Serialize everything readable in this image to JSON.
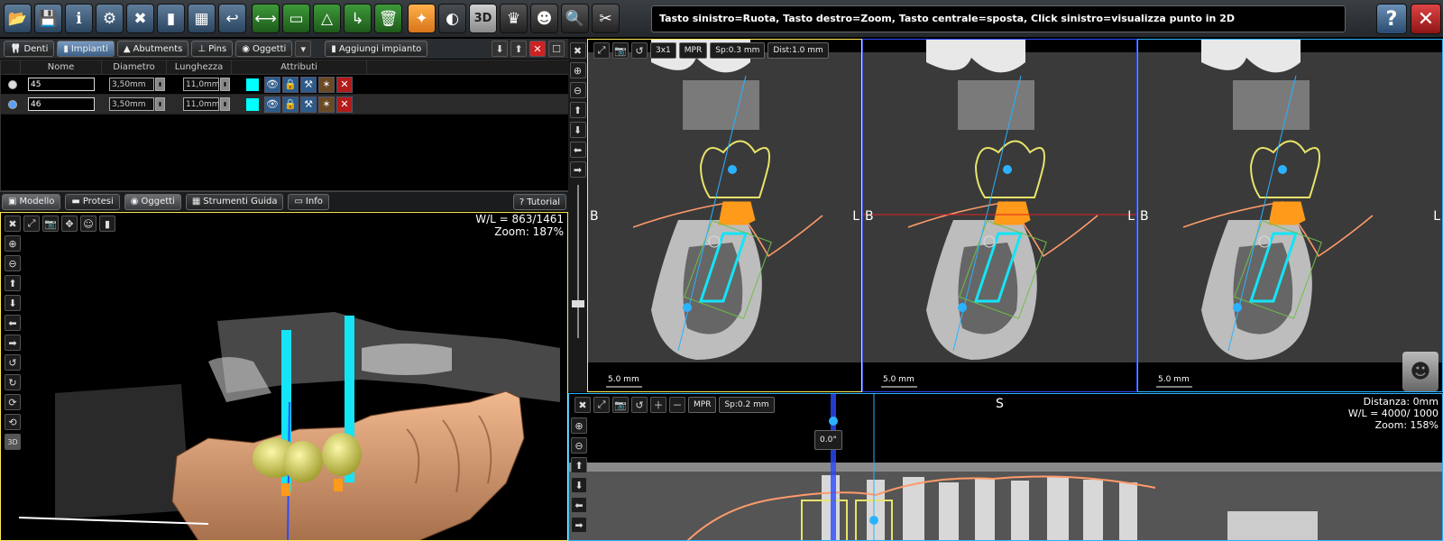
{
  "toolbar": {
    "buttons": [
      {
        "name": "folder-open-icon",
        "glyph": "📂",
        "style": "blue"
      },
      {
        "name": "save-icon",
        "glyph": "💾",
        "style": "blue"
      },
      {
        "name": "info-icon",
        "glyph": "ℹ",
        "style": "blue"
      },
      {
        "name": "settings-icon",
        "glyph": "⚙",
        "style": "blue"
      },
      {
        "name": "tools-icon",
        "glyph": "✖",
        "style": "blue"
      },
      {
        "name": "implant-icon",
        "glyph": "▮",
        "style": "blue"
      },
      {
        "name": "calculator-icon",
        "glyph": "▦",
        "style": "blue"
      },
      {
        "name": "undo-icon",
        "glyph": "↩",
        "style": "blue"
      },
      {
        "name": "measure-icon",
        "glyph": "⟷",
        "style": "green"
      },
      {
        "name": "presentation-icon",
        "glyph": "▭",
        "style": "green"
      },
      {
        "name": "angle-icon",
        "glyph": "△",
        "style": "green"
      },
      {
        "name": "export-icon",
        "glyph": "↳",
        "style": "green"
      },
      {
        "name": "trash-icon",
        "glyph": "🗑",
        "style": "green"
      },
      {
        "name": "nerve-icon",
        "glyph": "✦",
        "style": "orange"
      },
      {
        "name": "contrast-icon",
        "glyph": "◐",
        "style": "red"
      },
      {
        "name": "view3d-icon",
        "glyph": "3D",
        "style": "gray"
      },
      {
        "name": "panorex-icon",
        "glyph": "♛",
        "style": "dark"
      },
      {
        "name": "skull-icon",
        "glyph": "☻",
        "style": "dark"
      },
      {
        "name": "zoom-search-icon",
        "glyph": "🔍",
        "style": "dark"
      },
      {
        "name": "scissors-icon",
        "glyph": "✂",
        "style": "dark"
      }
    ],
    "hint": "Tasto sinistro=Ruota, Tasto destro=Zoom, Tasto centrale=sposta, Click sinistro=visualizza punto in 2D",
    "help_label": "?",
    "close_label": "✕"
  },
  "panel_tabs": {
    "items": [
      "Denti",
      "Impianti",
      "Abutments",
      "Pins",
      "Oggetti"
    ],
    "active": "Impianti",
    "add_label": "Aggiungi impianto"
  },
  "implants_table": {
    "headers": [
      "Nome",
      "Diametro",
      "Lunghezza",
      "Attributi"
    ],
    "rows": [
      {
        "name": "45",
        "diameter": "3,50mm",
        "length": "11,0mm",
        "selected": false
      },
      {
        "name": "46",
        "diameter": "3,50mm",
        "length": "11,0mm",
        "selected": true
      }
    ]
  },
  "model_tabs": {
    "items": [
      "Modello",
      "Protesi",
      "Oggetti",
      "Strumenti Guida",
      "Info"
    ],
    "tutorial": "Tutorial"
  },
  "view3d": {
    "wl": "W/L = 863/1461",
    "zoom": "Zoom: 187%",
    "side_button": "3D"
  },
  "ct_views": {
    "chips": [
      "3x1",
      "MPR",
      "Sp:0.3 mm",
      "Dist:1.0 mm"
    ],
    "left_label": "B",
    "right_label": "L",
    "scale_label": "5.0 mm"
  },
  "pano": {
    "chips": [
      "MPR",
      "Sp:0.2 mm"
    ],
    "top_label": "S",
    "angle": "0.0°",
    "distance": "Distanza: 0mm",
    "wl": "W/L = 4000/ 1000",
    "zoom": "Zoom: 158%"
  },
  "colors": {
    "accent_yellow": "#ffea55",
    "accent_blue": "#2b4bff",
    "accent_cyan": "#2bb2ff",
    "implant": "#00e5ff",
    "abutment": "#ff9a1a",
    "crown": "#e8e46a",
    "nerve": "#ff9a6a"
  }
}
